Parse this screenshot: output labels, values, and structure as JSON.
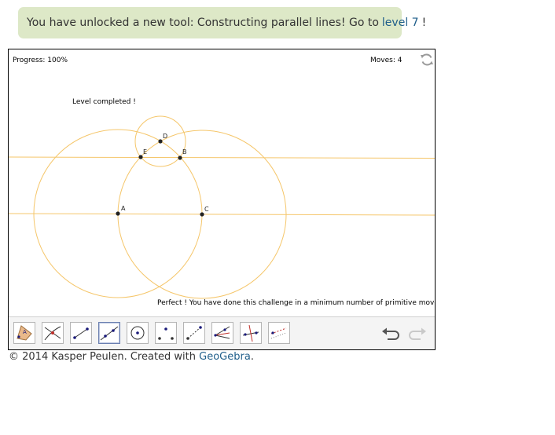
{
  "notice": {
    "text": "You have unlocked a new tool: Constructing parallel lines! Go to",
    "link": "level 7",
    "suffix": "!"
  },
  "applet": {
    "progress": "Progress: 100%",
    "moves": "Moves: 4",
    "status": "Level completed !",
    "success": "Perfect ! You have done this challenge in a minimum number of primitive moves!",
    "points": [
      {
        "label": "A"
      },
      {
        "label": "B"
      },
      {
        "label": "C"
      },
      {
        "label": "D"
      },
      {
        "label": "E"
      }
    ],
    "colors": {
      "construction": "#f5c66a",
      "point": "#222222",
      "toolbar_bg": "#f4f4f4",
      "notice_bg": "#dde8c7",
      "link": "#1f5e8a"
    },
    "toolbar": {
      "tools": [
        {
          "icon": "polygon-tool-icon"
        },
        {
          "icon": "intersect-tool-icon"
        },
        {
          "icon": "segment-tool-icon"
        },
        {
          "icon": "line-tool-icon",
          "active": true
        },
        {
          "icon": "circle-tool-icon"
        },
        {
          "icon": "midpoint-tool-icon"
        },
        {
          "icon": "reflect-tool-icon"
        },
        {
          "icon": "angle-bisector-tool-icon"
        },
        {
          "icon": "perpendicular-bisector-tool-icon"
        },
        {
          "icon": "parallel-line-tool-icon"
        }
      ],
      "undo": "undo-icon",
      "redo": "redo-icon"
    }
  },
  "footer": {
    "text": "© 2014 Kasper Peulen. Created with",
    "link": "GeoGebra",
    "suffix": "."
  }
}
